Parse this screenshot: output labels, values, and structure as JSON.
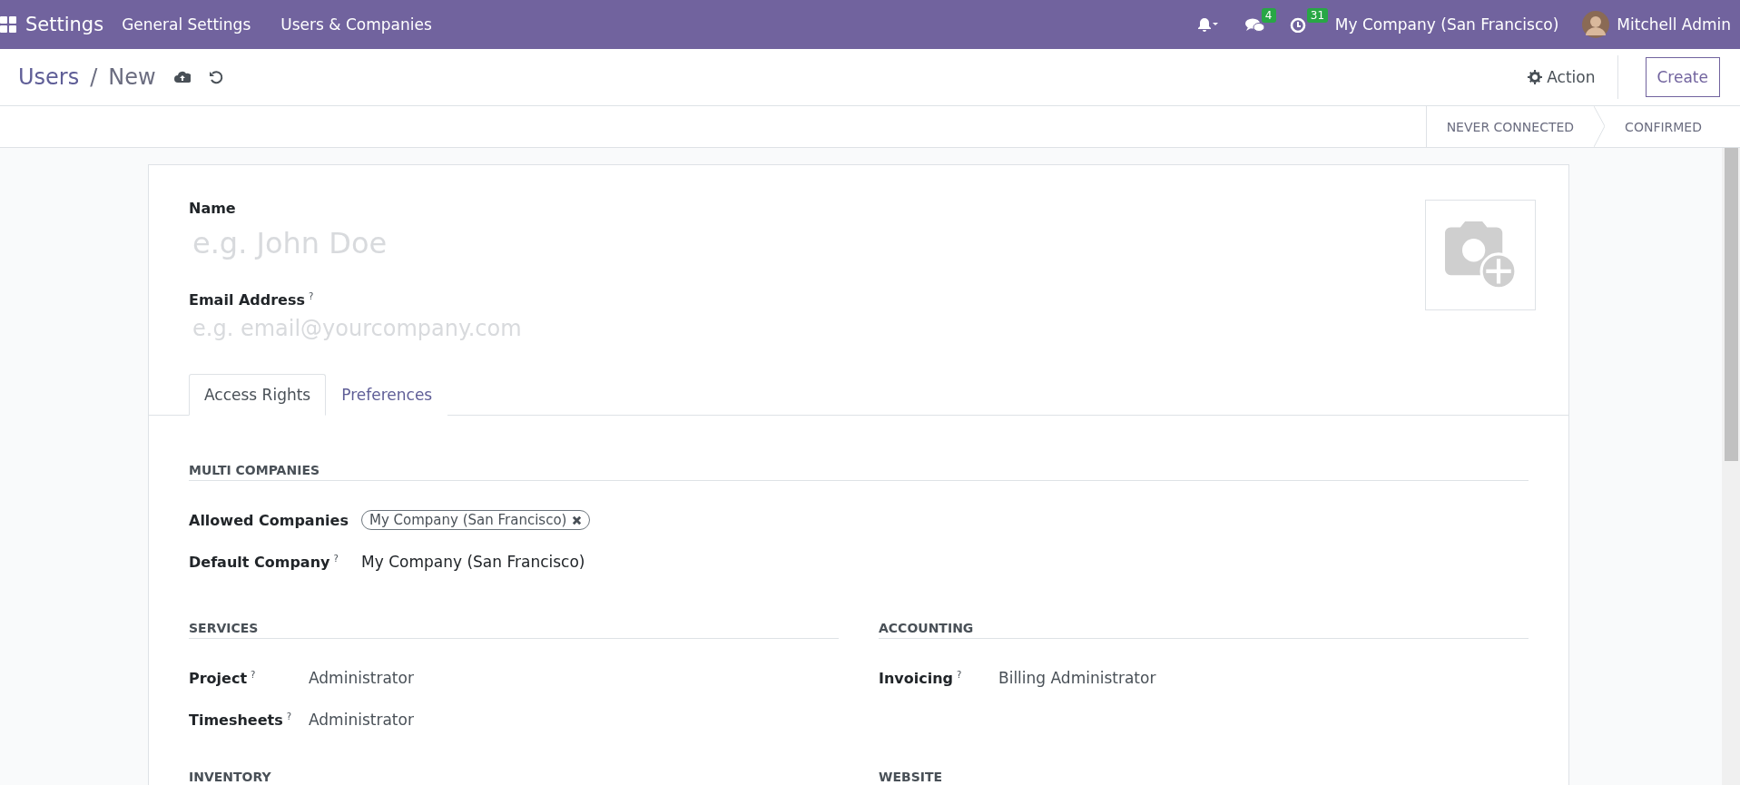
{
  "navbar": {
    "app_name": "Settings",
    "menus": [
      {
        "label": "General Settings"
      },
      {
        "label": "Users & Companies"
      }
    ],
    "systray": [
      {
        "kind": "bell"
      },
      {
        "kind": "chat",
        "badge": "4"
      },
      {
        "kind": "clock",
        "badge": "31"
      }
    ],
    "company": "My Company (San Francisco)",
    "user": "Mitchell Admin"
  },
  "control_panel": {
    "breadcrumb": [
      {
        "label": "Users"
      },
      {
        "label": "New"
      }
    ],
    "separator": "/",
    "action": "Action",
    "create": "Create"
  },
  "statusbar": {
    "stages": [
      {
        "label": "NEVER CONNECTED",
        "selected": false
      },
      {
        "label": "CONFIRMED",
        "selected": false
      }
    ]
  },
  "form": {
    "name": {
      "label": "Name",
      "placeholder": "e.g. John Doe"
    },
    "email": {
      "label": "Email Address",
      "help": "?",
      "placeholder": "e.g. email@yourcompany.com"
    },
    "tabs": [
      {
        "label": "Access Rights",
        "selected": true
      },
      {
        "label": "Preferences",
        "selected": false
      }
    ],
    "multi_companies": {
      "heading": "MULTI COMPANIES",
      "fields": [
        {
          "label": "Allowed Companies",
          "kind": "tags",
          "tags": [
            "My Company (San Francisco)"
          ]
        },
        {
          "label": "Default Company",
          "help": "?",
          "kind": "many2one",
          "value": "My Company (San Francisco)"
        }
      ]
    },
    "app_sections": [
      {
        "heading": "SERVICES",
        "fields": [
          {
            "label": "Project",
            "help": "?",
            "kind": "selection",
            "value": "Administrator"
          },
          {
            "label": "Timesheets",
            "help": "?",
            "kind": "selection",
            "value": "Administrator"
          }
        ]
      },
      {
        "heading": "ACCOUNTING",
        "fields": [
          {
            "label": "Invoicing",
            "help": "?",
            "kind": "selection",
            "value": "Billing Administrator"
          }
        ]
      },
      {
        "heading": "INVENTORY"
      },
      {
        "heading": "WEBSITE"
      }
    ]
  }
}
